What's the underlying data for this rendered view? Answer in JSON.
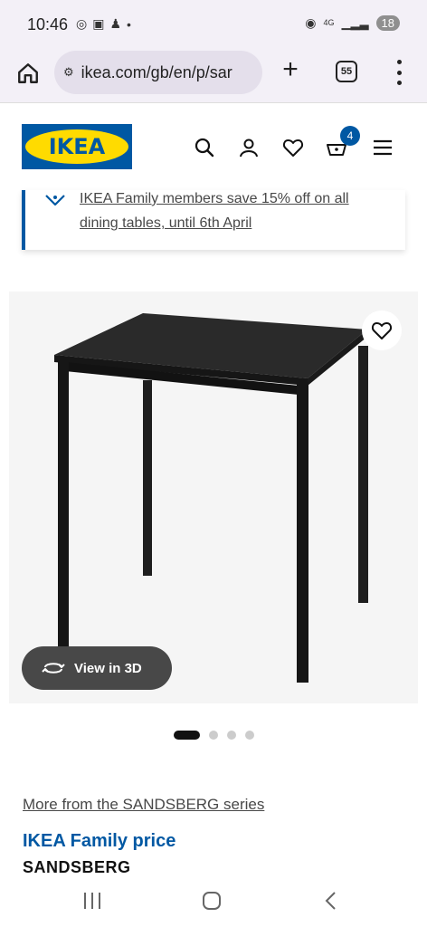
{
  "status_bar": {
    "time": "10:46",
    "network": "4G",
    "battery": "18"
  },
  "browser": {
    "url": "ikea.com/gb/en/p/sar",
    "tab_count": "55"
  },
  "header": {
    "logo_text": "IKEA",
    "basket_count": "4"
  },
  "promo": {
    "text": "IKEA Family members save 15% off on all dining tables, until 6th April"
  },
  "product": {
    "view_3d_label": "View in 3D",
    "image_count": 4,
    "active_image": 1,
    "series_link": "More from the SANDSBERG series",
    "family_price_label": "IKEA Family price",
    "name": "SANDSBERG"
  },
  "colors": {
    "ikea_blue": "#0058a3",
    "ikea_yellow": "#ffdb00"
  }
}
